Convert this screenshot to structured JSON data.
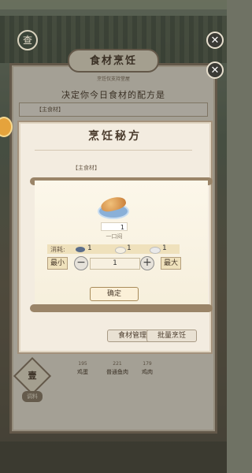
{
  "main": {
    "title": "食材烹饪",
    "subtitle": "烹饪仅支持堂屋",
    "desc": "决定你今日食材的配方是",
    "strip_label": "【主食材】",
    "ingredients": [
      {
        "count": "195",
        "name": "鸡蛋"
      },
      {
        "count": "221",
        "name": "普通鱼肉"
      },
      {
        "count": "179",
        "name": "鸡肉"
      }
    ],
    "diamond_label": "壹",
    "tab_label": "调料"
  },
  "left_button": "查",
  "dialog": {
    "title": "烹饪秘方",
    "strip_label": "【主食材】",
    "manage_button": "食材管理",
    "batch_button": "批量烹饪"
  },
  "popup": {
    "dish_count": "1",
    "dish_name": "一口闷",
    "cost_label": "消耗:",
    "costs": [
      {
        "icon": "fish-icon",
        "value": "1",
        "color": "#5a6d8a"
      },
      {
        "icon": "egg-icon",
        "value": "1",
        "color": "#f5efe0"
      },
      {
        "icon": "rice-icon",
        "value": "1",
        "color": "#e9e9e9"
      }
    ],
    "min_label": "最小",
    "max_label": "最大",
    "minus": "−",
    "plus": "+",
    "quantity": "1",
    "confirm_label": "确定"
  }
}
